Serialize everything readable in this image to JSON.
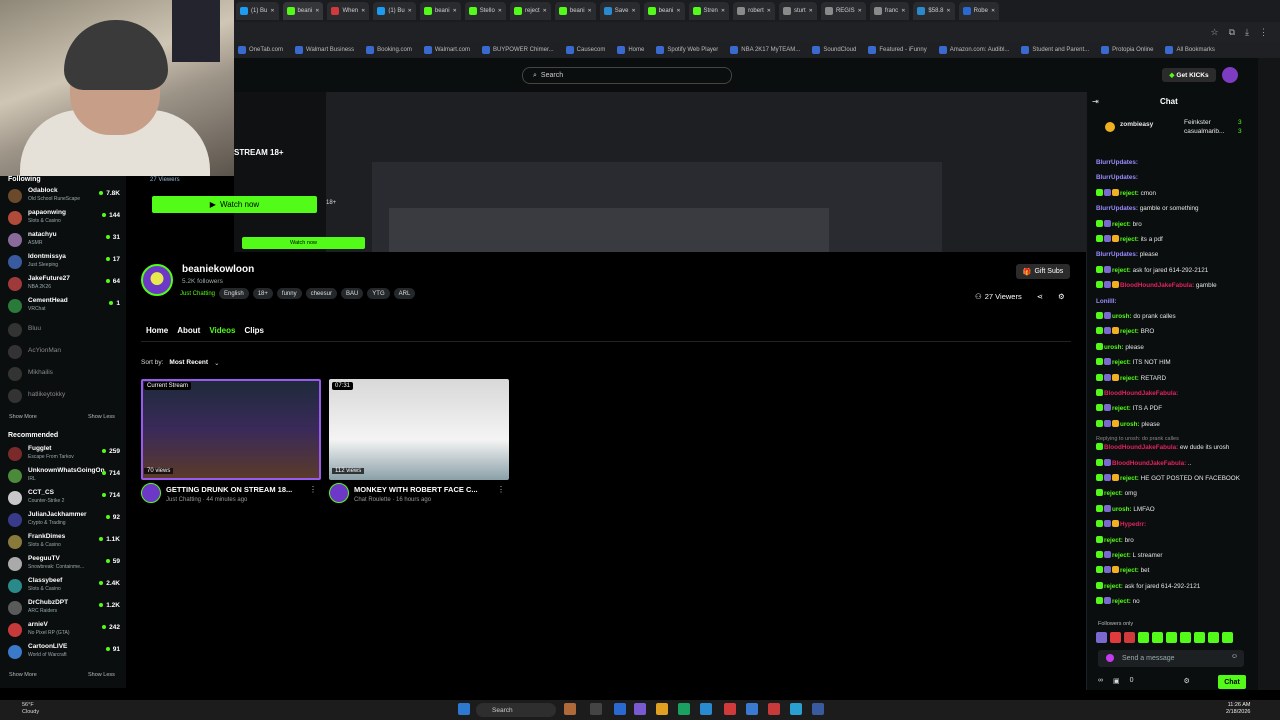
{
  "browser": {
    "tabs": [
      "(1) Bu",
      "beani",
      "When",
      "(1) Bu",
      "beani",
      "Stello",
      "reject",
      "beani",
      "Save",
      "beani",
      "Stren",
      "robert",
      "sturt",
      "REGIS",
      "franc",
      "$58.8",
      "Robe"
    ],
    "bookmarks": [
      "OneTab.com",
      "Walmart Business",
      "Booking.com",
      "Walmart.com",
      "BUYPOWER Chimer...",
      "Causecom",
      "Home",
      "Spotify Web Player",
      "NBA 2K17 MyTEAM...",
      "SoundCloud",
      "Featured - iFunny",
      "Amazon.com: Audibl...",
      "Student and Parent...",
      "Protopia Online",
      "All Bookmarks"
    ]
  },
  "header": {
    "search_placeholder": "Search",
    "get_kicks": "Get KICKs"
  },
  "stream": {
    "label": "STREAM 18+",
    "viewers": "27 Viewers",
    "watch_now": "Watch now",
    "plus18": "18+",
    "nested_watch": "Watch now"
  },
  "sidebar": {
    "following_heading": "Following",
    "following": [
      {
        "name": "Odablock",
        "category": "Old School RuneScape",
        "count": "7.8K",
        "color": "#6a4a2a"
      },
      {
        "name": "papaonwing",
        "category": "Slots & Casino",
        "count": "144",
        "color": "#b04a3a"
      },
      {
        "name": "natachyu",
        "category": "ASMR",
        "count": "31",
        "color": "#8a6a9a"
      },
      {
        "name": "Idontmissya",
        "category": "Just Sleeping",
        "count": "17",
        "color": "#3a5aa0"
      },
      {
        "name": "JakeFuture27",
        "category": "NBA 2K26",
        "count": "64",
        "color": "#a03a3a"
      },
      {
        "name": "CementHead",
        "category": "VRChat",
        "count": "1",
        "color": "#2a7a3a"
      }
    ],
    "offline": [
      "Bluu",
      "AcYionMan",
      "Mikhailis",
      "hatlikeytokky"
    ],
    "show_more": "Show More",
    "show_less": "Show Less",
    "recommended_heading": "Recommended",
    "recommended": [
      {
        "name": "Fugglet",
        "category": "Escape From Tarkov",
        "count": "259",
        "color": "#7a2a2a"
      },
      {
        "name": "UnknownWhatsGoingOn",
        "category": "IRL",
        "count": "714",
        "color": "#4a8a3a"
      },
      {
        "name": "CCT_CS",
        "category": "Counter-Strike 2",
        "count": "714",
        "color": "#c8c8c8"
      },
      {
        "name": "JulianJackhammer",
        "category": "Crypto & Trading",
        "count": "92",
        "color": "#3a3a8a"
      },
      {
        "name": "FrankDimes",
        "category": "Slots & Casino",
        "count": "1.1K",
        "color": "#8a7a3a"
      },
      {
        "name": "PeeguuTV",
        "category": "Snowbreak: Containme...",
        "count": "59",
        "color": "#aaaaaa"
      },
      {
        "name": "Classybeef",
        "category": "Slots & Casino",
        "count": "2.4K",
        "color": "#2a8a8a"
      },
      {
        "name": "DrChubzDPT",
        "category": "ARC Raiders",
        "count": "1.2K",
        "color": "#5a5a5a"
      },
      {
        "name": "arnieV",
        "category": "No Pixel RP (GTA)",
        "count": "242",
        "color": "#c83a3a"
      },
      {
        "name": "CartoonLIVE",
        "category": "World of Warcraft",
        "count": "91",
        "color": "#3a7ac8"
      }
    ]
  },
  "channel": {
    "name": "beaniekowloon",
    "followers": "5.2K followers",
    "category": "Just Chatting",
    "tags": [
      "English",
      "18+",
      "funny",
      "cheesur",
      "BAU",
      "YTG",
      "ARL"
    ],
    "gift_subs": "Gift Subs",
    "viewers": "27 Viewers",
    "tabs": [
      "Home",
      "About",
      "Videos",
      "Clips"
    ],
    "active_tab": "Videos",
    "sort_label": "Sort by:",
    "sort_value": "Most Recent"
  },
  "videos": [
    {
      "badge": "Current Stream",
      "views": "70 views",
      "title": "GETTING DRUNK ON STREAM 18...",
      "sub": "Just Chatting · 44 minutes ago"
    },
    {
      "badge": "07:31",
      "views": "112 views",
      "title": "MONKEY WITH ROBERT FACE C...",
      "sub": "Chat Roulette · 16 hours ago"
    }
  ],
  "chat": {
    "title": "Chat",
    "pinned_user": "zombieasy",
    "pinned_right1": "Feinkster",
    "pinned_right2": "casualmarib...",
    "pinned_n1": "3",
    "pinned_n2": "3",
    "messages": [
      {
        "user": "BlurrUpdates:",
        "text": "",
        "color": "#9a8cff"
      },
      {
        "user": "BlurrUpdates:",
        "text": "",
        "color": "#9a8cff"
      },
      {
        "user": "reject:",
        "text": "cmon",
        "color": "#53fc18"
      },
      {
        "user": "BlurrUpdates:",
        "text": "gamble or something",
        "color": "#9a8cff"
      },
      {
        "user": "reject:",
        "text": "bro",
        "color": "#53fc18"
      },
      {
        "user": "reject:",
        "text": "its a pdf",
        "color": "#53fc18"
      },
      {
        "user": "BlurrUpdates:",
        "text": "please",
        "color": "#9a8cff"
      },
      {
        "user": "reject:",
        "text": "ask for jared 614-292-2121",
        "color": "#53fc18"
      },
      {
        "user": "BloodHoundJakeFabula:",
        "text": "gamble",
        "color": "#e0245e"
      },
      {
        "user": "LonillI:",
        "text": "",
        "color": "#9a8cff"
      },
      {
        "user": "urosh:",
        "text": "do prank calles",
        "color": "#53fc18"
      },
      {
        "user": "reject:",
        "text": "BRO",
        "color": "#53fc18"
      },
      {
        "user": "urosh:",
        "text": "please",
        "color": "#53fc18"
      },
      {
        "user": "reject:",
        "text": "ITS NOT HIM",
        "color": "#53fc18"
      },
      {
        "user": "reject:",
        "text": "RETARD",
        "color": "#53fc18"
      },
      {
        "user": "BloodHoundJakeFabula:",
        "text": "",
        "color": "#e0245e"
      },
      {
        "user": "reject:",
        "text": "ITS A PDF",
        "color": "#53fc18"
      },
      {
        "user": "urosh:",
        "text": "please",
        "color": "#53fc18"
      },
      {
        "user": "BloodHoundJakeFabula:",
        "text": "ew dude its urosh",
        "color": "#e0245e",
        "reply": "Replying to urosh: do prank calles"
      },
      {
        "user": "BloodHoundJakeFabula:",
        "text": "..",
        "color": "#e0245e"
      },
      {
        "user": "reject:",
        "text": "HE GOT POSTED ON FACEBOOK",
        "color": "#53fc18"
      },
      {
        "user": "reject:",
        "text": "omg",
        "color": "#53fc18"
      },
      {
        "user": "urosh:",
        "text": "LMFAO",
        "color": "#53fc18"
      },
      {
        "user": "Hypedrr:",
        "text": "",
        "color": "#e0245e"
      },
      {
        "user": "reject:",
        "text": "bro",
        "color": "#53fc18"
      },
      {
        "user": "reject:",
        "text": "L streamer",
        "color": "#53fc18"
      },
      {
        "user": "reject:",
        "text": "bet",
        "color": "#53fc18"
      },
      {
        "user": "reject:",
        "text": "ask for jared 614-292-2121",
        "color": "#53fc18"
      },
      {
        "user": "reject:",
        "text": "no",
        "color": "#53fc18"
      }
    ],
    "followers_only": "Followers only",
    "send_placeholder": "Send a message",
    "chat_button": "Chat",
    "bottom_count": "0"
  },
  "taskbar": {
    "weather_temp": "56°F",
    "weather_desc": "Cloudy",
    "search": "Search",
    "time": "11:26 AM",
    "date": "2/18/2026"
  }
}
